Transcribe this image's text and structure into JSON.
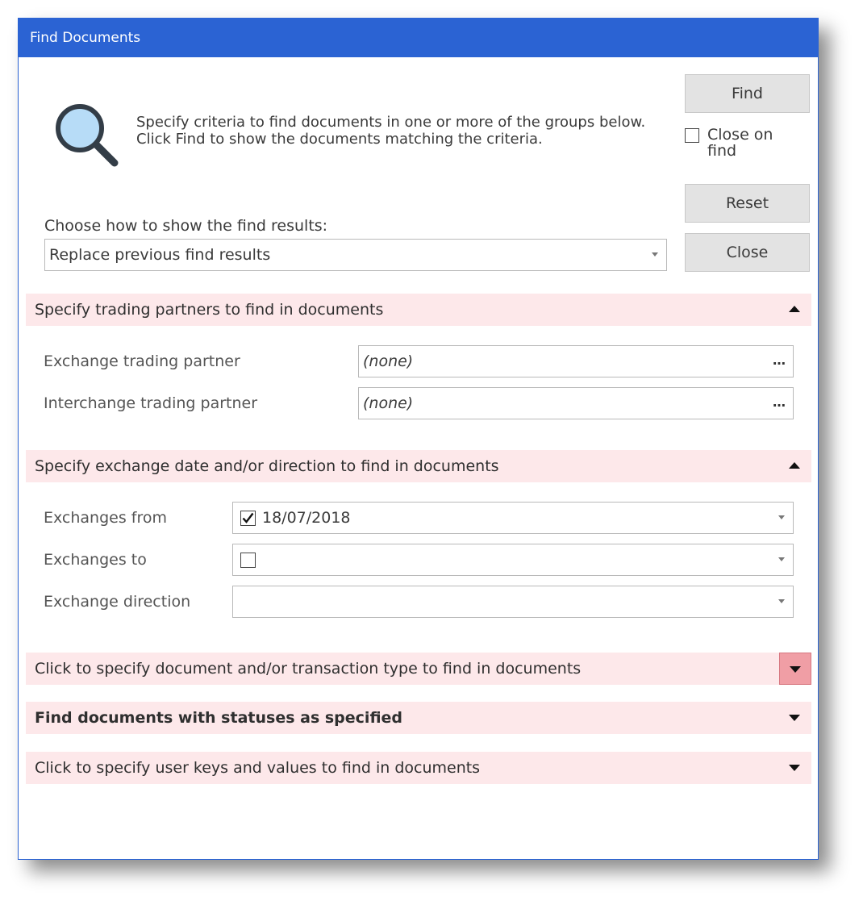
{
  "window": {
    "title": "Find Documents"
  },
  "intro": {
    "text": "Specify criteria to find documents in one or more of the groups below.  Click Find to show the documents matching the criteria."
  },
  "buttons": {
    "find": "Find",
    "reset": "Reset",
    "close": "Close"
  },
  "close_on_find": {
    "label": "Close on find",
    "checked": false
  },
  "results_mode": {
    "label": "Choose how to show the find results:",
    "selected": "Replace previous find results"
  },
  "groups": {
    "trading_partners": {
      "header": "Specify trading partners to find in documents",
      "exchange_label": "Exchange trading partner",
      "exchange_value": "(none)",
      "interchange_label": "Interchange trading partner",
      "interchange_value": "(none)"
    },
    "exchange_date": {
      "header": "Specify exchange date and/or direction to find in documents",
      "from_label": "Exchanges from",
      "from_value": "18/07/2018",
      "from_checked": true,
      "to_label": "Exchanges to",
      "to_value": "",
      "to_checked": false,
      "direction_label": "Exchange direction",
      "direction_value": ""
    },
    "doc_type": {
      "header": "Click to specify document and/or transaction type to find in documents"
    },
    "statuses": {
      "header": "Find documents with statuses as specified"
    },
    "user_keys": {
      "header": "Click to specify user keys and values to find in documents"
    }
  },
  "icons": {
    "search": "magnifier-icon",
    "ellipsis": "…"
  },
  "colors": {
    "titlebar": "#2b63d3",
    "group_bg": "#fde8ea",
    "expand_active": "#f09ea5"
  }
}
